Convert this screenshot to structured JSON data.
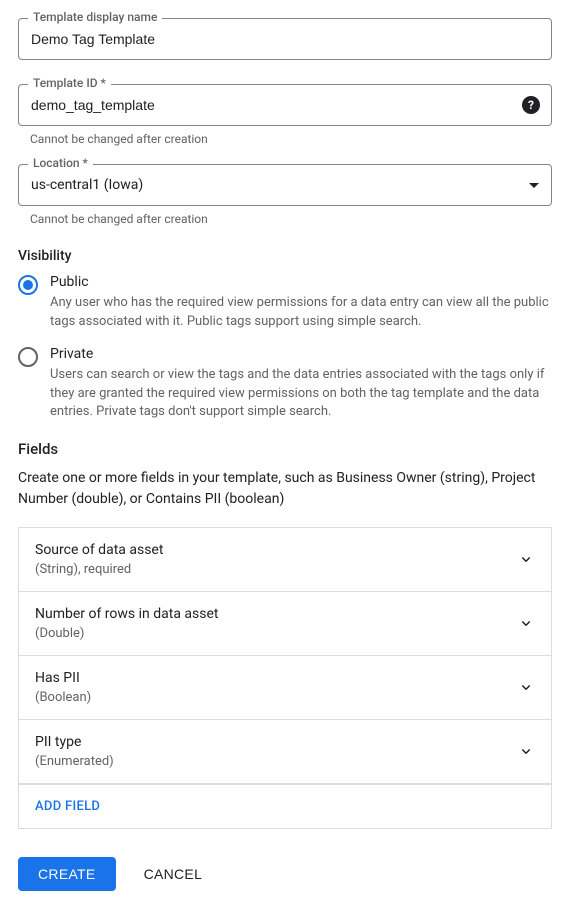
{
  "displayName": {
    "label": "Template display name",
    "value": "Demo Tag Template"
  },
  "templateId": {
    "label": "Template ID *",
    "value": "demo_tag_template",
    "helper": "Cannot be changed after creation"
  },
  "location": {
    "label": "Location *",
    "value": "us-central1 (Iowa)",
    "helper": "Cannot be changed after creation"
  },
  "visibility": {
    "title": "Visibility",
    "options": [
      {
        "label": "Public",
        "desc": "Any user who has the required view permissions for a data entry can view all the public tags associated with it. Public tags support using simple search.",
        "selected": true
      },
      {
        "label": "Private",
        "desc": "Users can search or view the tags and the data entries associated with the tags only if they are granted the required view permissions on both the tag template and the data entries. Private tags don't support simple search.",
        "selected": false
      }
    ]
  },
  "fieldsSection": {
    "title": "Fields",
    "desc": "Create one or more fields in your template, such as Business Owner (string), Project Number (double), or Contains PII (boolean)",
    "items": [
      {
        "title": "Source of data asset",
        "sub": "(String), required"
      },
      {
        "title": "Number of rows in data asset",
        "sub": "(Double)"
      },
      {
        "title": "Has PII",
        "sub": "(Boolean)"
      },
      {
        "title": "PII type",
        "sub": "(Enumerated)"
      }
    ],
    "addLabel": "ADD FIELD"
  },
  "buttons": {
    "create": "CREATE",
    "cancel": "CANCEL"
  }
}
